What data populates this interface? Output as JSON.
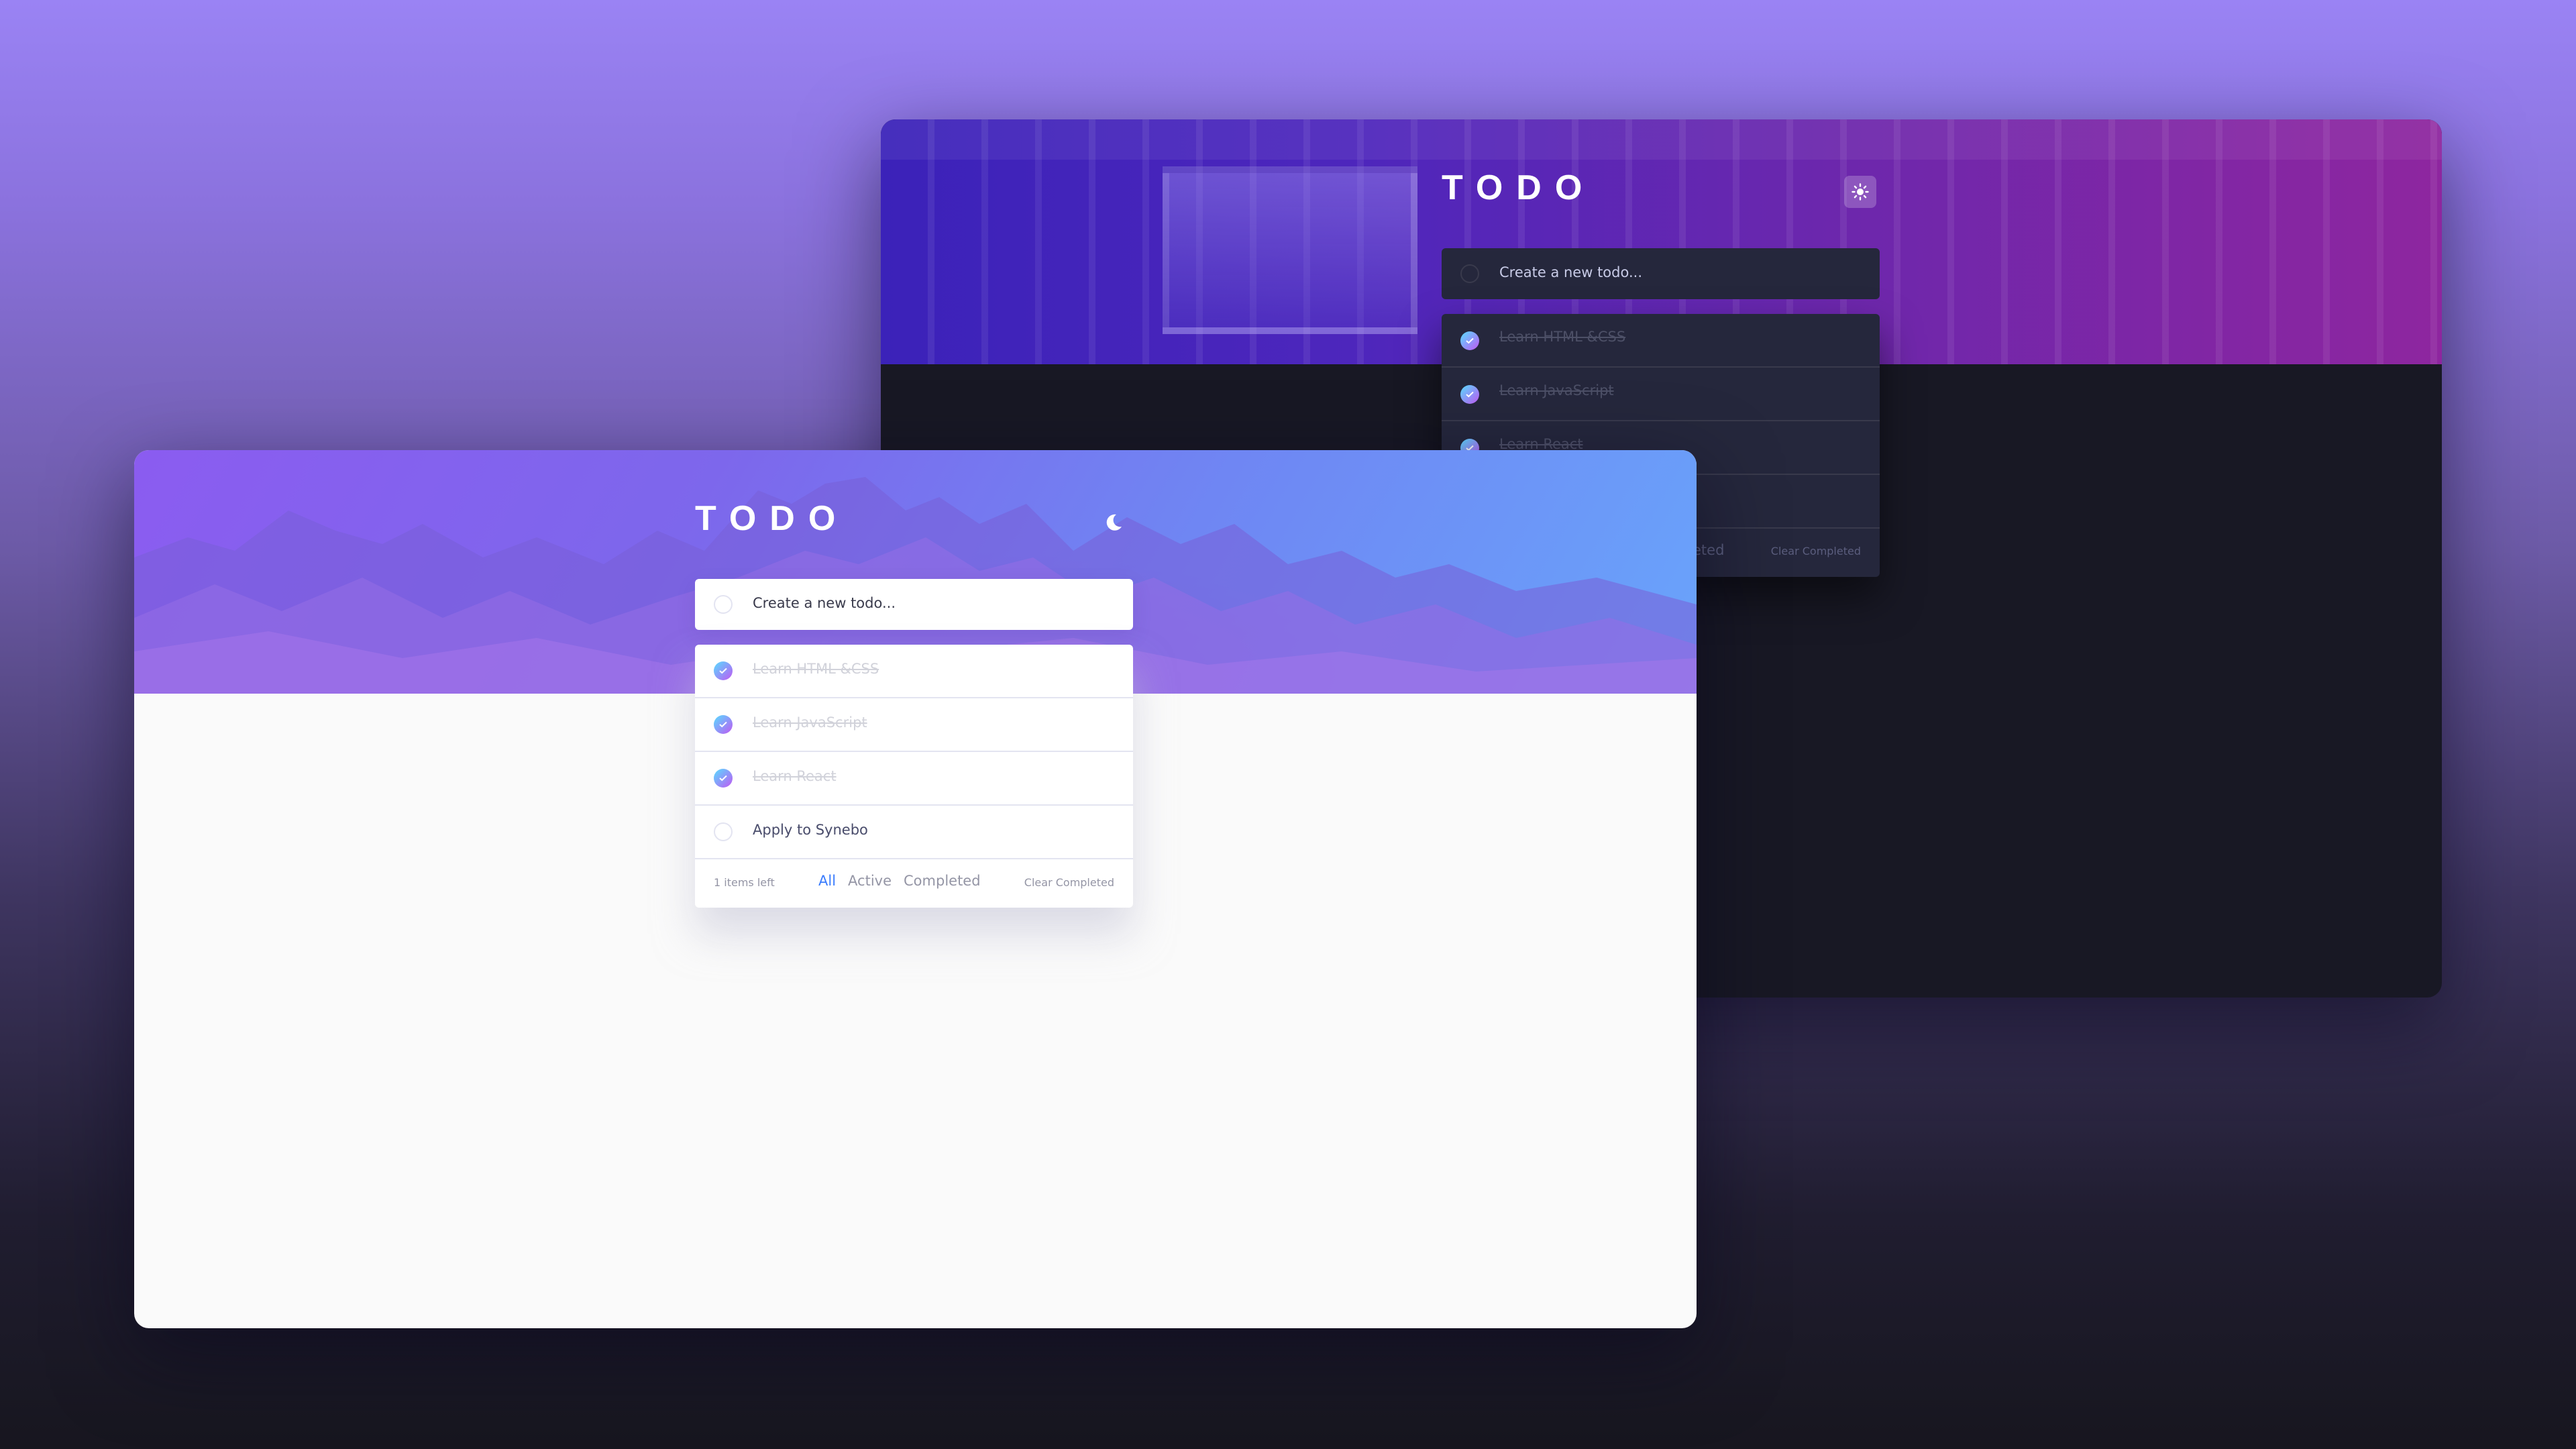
{
  "dark_app": {
    "title": "TODO",
    "theme_toggle_icon": "sun-icon",
    "new_todo_placeholder": "Create a new todo...",
    "todos": [
      {
        "text": "Learn HTML &CSS",
        "completed": true
      },
      {
        "text": "Learn JavaScript",
        "completed": true
      },
      {
        "text": "Learn React",
        "completed": true
      }
    ],
    "footer": {
      "completed_label_partial": "eted",
      "clear_label": "Clear Completed"
    }
  },
  "light_app": {
    "title": "TODO",
    "theme_toggle_icon": "moon-icon",
    "new_todo_placeholder": "Create a new todo...",
    "todos": [
      {
        "text": "Learn HTML &CSS",
        "completed": true
      },
      {
        "text": "Learn JavaScript",
        "completed": true
      },
      {
        "text": "Learn React",
        "completed": true
      },
      {
        "text": "Apply to Synebo",
        "completed": false
      }
    ],
    "footer": {
      "items_left": "1 items left",
      "filters": [
        "All",
        "Active",
        "Completed"
      ],
      "active_filter": "All",
      "clear_label": "Clear Completed"
    }
  },
  "colors": {
    "accent_blue": "#3a7cfd",
    "check_gradient_start": "#57ddff",
    "check_gradient_end": "#c058f3",
    "dark_surface": "#25273c",
    "dark_background": "#181824",
    "light_background": "#fafafa"
  }
}
